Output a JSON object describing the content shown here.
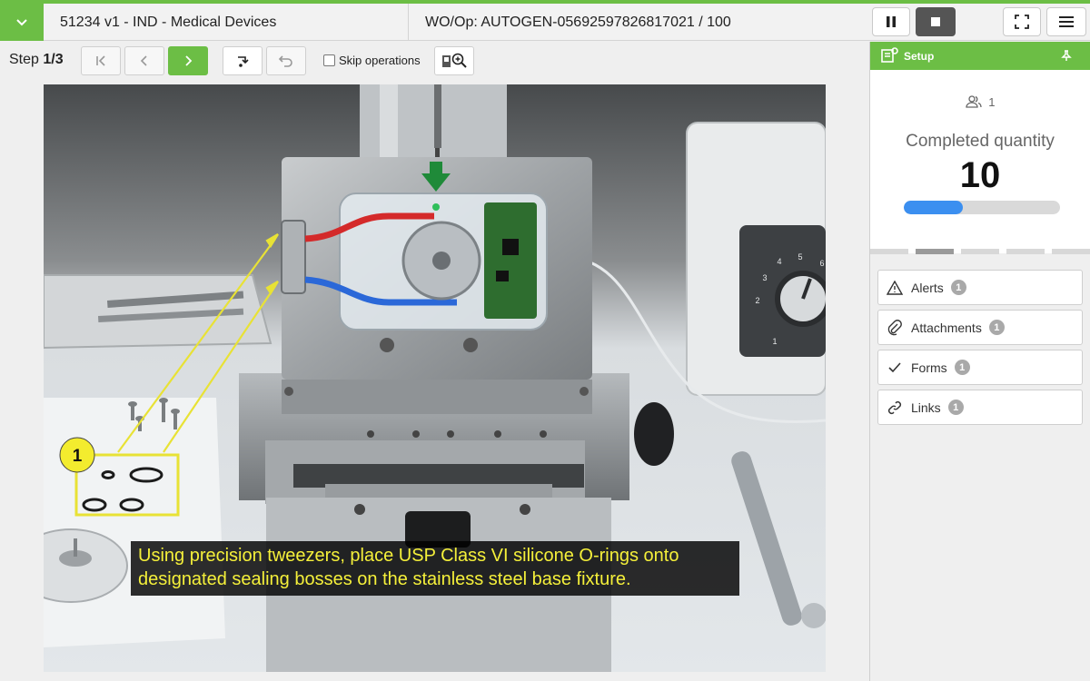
{
  "header": {
    "title": "51234 v1 - IND - Medical Devices",
    "wo_op": "WO/Op:  AUTOGEN-05692597826817021 / 100"
  },
  "toolbar": {
    "step_prefix": "Step",
    "step_value": "1/3",
    "skip_label": "Skip operations"
  },
  "instruction": {
    "callout_number": "1",
    "caption": "Using precision tweezers, place USP Class VI silicone O-rings onto designated sealing bosses on the stainless steel base fixture."
  },
  "photo_scale": {
    "dial_numbers": [
      "1",
      "2",
      "3",
      "4",
      "5",
      "6"
    ]
  },
  "panel": {
    "title": "Setup",
    "users_count": "1",
    "completed_label": "Completed quantity",
    "completed_value": "10",
    "progress_fraction": 0.38
  },
  "side_items": [
    {
      "label": "Alerts",
      "count": "1",
      "icon": "warning-icon"
    },
    {
      "label": "Attachments",
      "count": "1",
      "icon": "paperclip-icon"
    },
    {
      "label": "Forms",
      "count": "1",
      "icon": "checkmark-icon"
    },
    {
      "label": "Links",
      "count": "1",
      "icon": "link-icon"
    }
  ],
  "colors": {
    "accent_green": "#6cbe45",
    "progress_blue": "#3b8ff0",
    "caption_text": "#f5f03a"
  }
}
